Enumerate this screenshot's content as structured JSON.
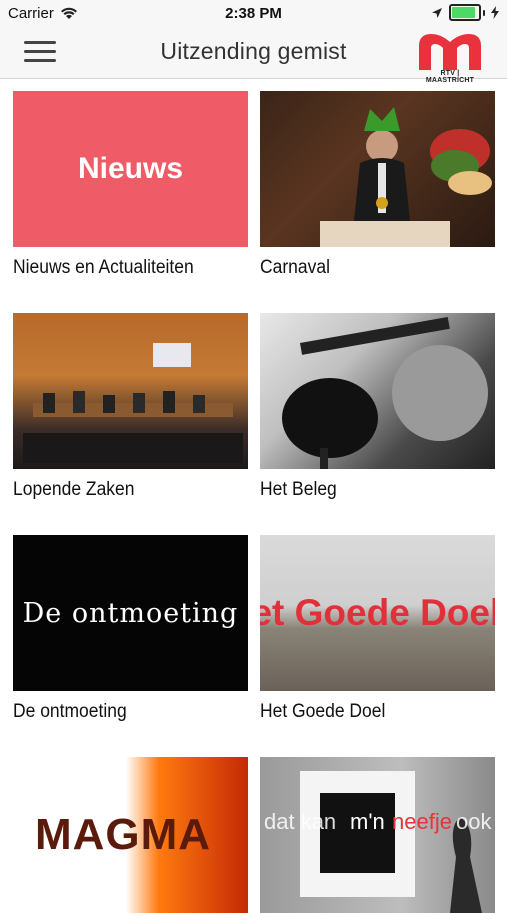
{
  "status_bar": {
    "carrier": "Carrier",
    "time": "2:38 PM",
    "battery_level": 0.95
  },
  "nav": {
    "title": "Uitzending gemist",
    "logo_text": "RTV | MAASTRICHT",
    "logo_color": "#e8323c"
  },
  "tiles": [
    {
      "title": "Nieuws en Actualiteiten",
      "thumb_text": "Nieuws"
    },
    {
      "title": "Carnaval"
    },
    {
      "title": "Lopende Zaken"
    },
    {
      "title": "Het Beleg"
    },
    {
      "title": "De ontmoeting",
      "thumb_text": "De ontmoeting"
    },
    {
      "title": "Het Goede Doel",
      "thumb_text": "Het Goede Doel"
    },
    {
      "title": "",
      "thumb_text": "MAGMA"
    },
    {
      "title": "",
      "thumb_text": "dat kan m'n neefje ook"
    }
  ]
}
